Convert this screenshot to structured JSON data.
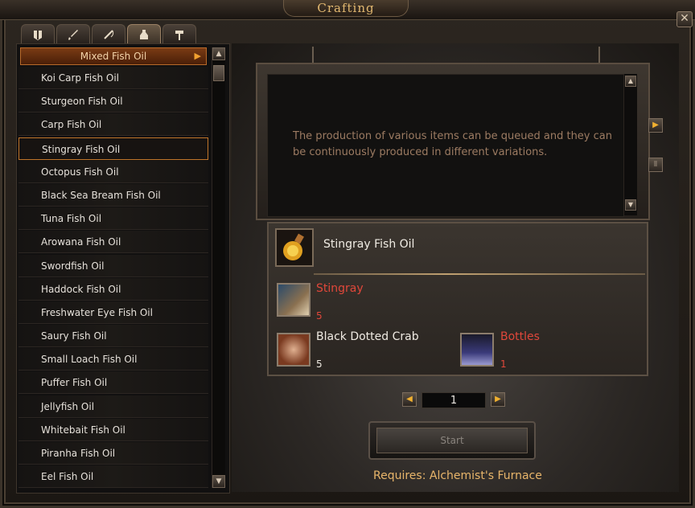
{
  "window": {
    "title": "Crafting",
    "close_glyph": "✕"
  },
  "tabs": [
    {
      "icon": "armor-icon",
      "active": false
    },
    {
      "icon": "sword-icon",
      "active": false
    },
    {
      "icon": "fishing-rod-icon",
      "active": false
    },
    {
      "icon": "potion-sack-icon",
      "active": true
    },
    {
      "icon": "hammer-icon",
      "active": false
    }
  ],
  "recipe_list": {
    "header": "Mixed Fish Oil",
    "header_arrow": "▶",
    "items": [
      "Koi Carp Fish Oil",
      "Sturgeon Fish Oil",
      "Carp Fish Oil",
      "Stingray Fish Oil",
      "Octopus Fish Oil",
      "Black Sea Bream Fish Oil",
      "Tuna Fish Oil",
      "Arowana Fish Oil",
      "Swordfish Oil",
      "Haddock Fish Oil",
      "Freshwater Eye Fish Oil",
      "Saury Fish Oil",
      "Small Loach Fish Oil",
      "Puffer Fish Oil",
      "Jellyfish Oil",
      "Whitebait Fish Oil",
      "Piranha Fish Oil",
      "Eel Fish Oil"
    ],
    "selected_index": 3
  },
  "description": "The production of various items can be queued and they can be continuously produced in different variations.",
  "product": {
    "name": "Stingray Fish Oil",
    "icon": "fish-oil-bottle-icon"
  },
  "materials": [
    {
      "name": "Stingray",
      "qty": "5",
      "insufficient": true,
      "icon": "stingray-icon"
    },
    {
      "name": "Black Dotted Crab",
      "qty": "5",
      "insufficient": false,
      "icon": "crab-icon"
    },
    {
      "name": "Bottles",
      "qty": "1",
      "insufficient": true,
      "icon": "bottle-icon"
    }
  ],
  "quantity": {
    "value": "1",
    "decrease_glyph": "◀",
    "increase_glyph": "▶"
  },
  "start_button": {
    "label": "Start"
  },
  "requirement": "Requires: Alchemist's Furnace",
  "colors": {
    "accent": "#e8b56a",
    "insufficient": "#e0473a",
    "selected_border": "#c0752a"
  }
}
